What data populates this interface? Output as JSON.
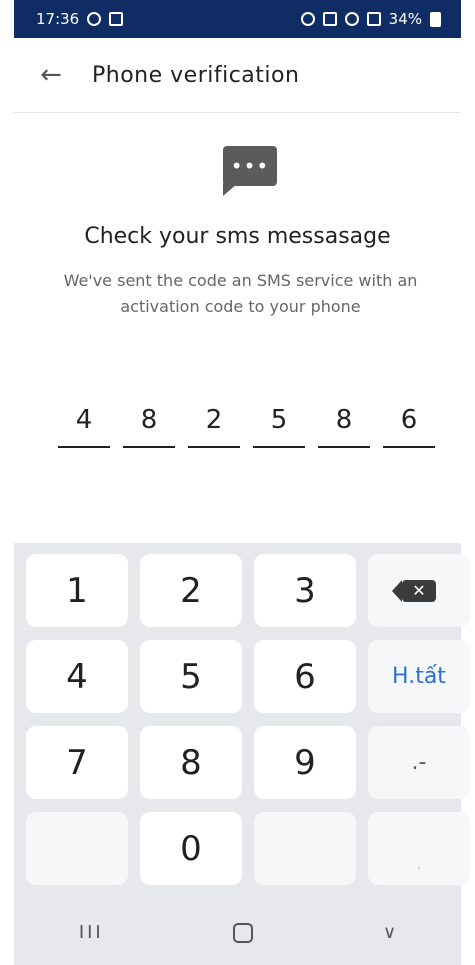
{
  "status_bar": {
    "time": "17:36",
    "battery": "34%",
    "icons_left": [
      "activity-icon",
      "image-icon"
    ],
    "icons_right": [
      "alarm-icon",
      "mute-icon",
      "wifi-icon",
      "signal-icon",
      "battery-icon"
    ]
  },
  "app_bar": {
    "back_icon": "←",
    "title": "Phone verification"
  },
  "content": {
    "sms_icon": "•••",
    "title": "Check your sms messasage",
    "description": "We've sent the code an SMS service with an activation code to your phone",
    "code_digits": [
      "4",
      "8",
      "2",
      "5",
      "8",
      "6"
    ]
  },
  "keyboard": {
    "keys": [
      "1",
      "2",
      "3",
      "4",
      "5",
      "6",
      "7",
      "8",
      "9",
      "0"
    ],
    "backspace_label": "✕",
    "done_label": "H.tất",
    "dot_dash_label": ".-",
    "comma_label": ","
  },
  "nav_bar": {
    "recents": "III",
    "back": "∨"
  },
  "colors": {
    "status_bar_bg": "#0f2c64",
    "keyboard_bg": "#e6e8eb",
    "accent_blue": "#2f6fcf"
  }
}
